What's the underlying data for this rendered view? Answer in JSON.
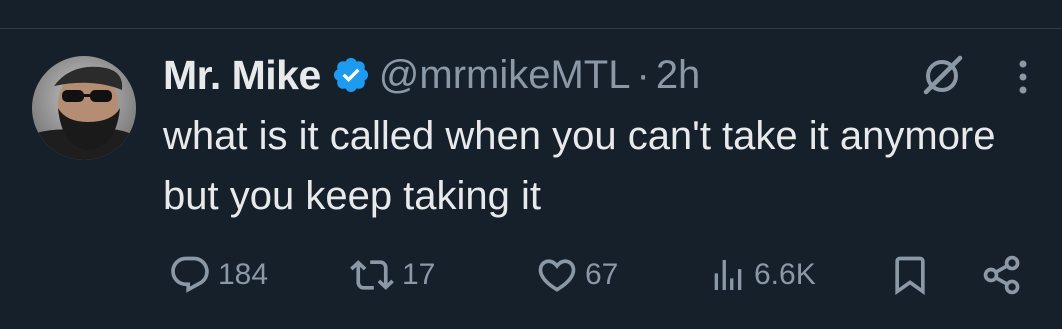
{
  "tweet": {
    "display_name": "Mr. Mike",
    "handle": "@mrmikeMTL",
    "separator": "·",
    "time": "2h",
    "text": "what is it called when you can't take it anymore but you keep taking it"
  },
  "actions": {
    "reply_count": "184",
    "retweet_count": "17",
    "like_count": "67",
    "view_count": "6.6K"
  },
  "icons": {
    "verified": "verified-badge-icon",
    "grok": "grok-icon",
    "more": "more-icon",
    "reply": "reply-icon",
    "retweet": "retweet-icon",
    "like": "heart-icon",
    "views": "views-icon",
    "bookmark": "bookmark-icon",
    "share": "share-icon"
  },
  "colors": {
    "background": "#15202b",
    "text_primary": "#e7e9ea",
    "text_secondary": "#8b98a5",
    "verified_blue": "#1d9bf0"
  }
}
